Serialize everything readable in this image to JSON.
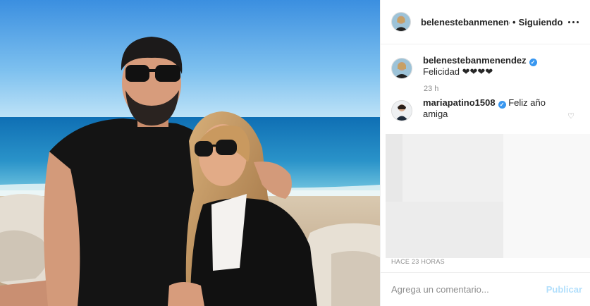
{
  "post": {
    "photo_alt_icon": "photo-image",
    "header": {
      "username": "belenestebanmenendez",
      "separator": "•",
      "follow_status": "Siguiendo",
      "more_icon": "more-options-icon"
    },
    "caption": {
      "username": "belenestebanmenendez",
      "verified": true,
      "text": "Felicidad ❤❤❤❤"
    },
    "caption_time": "23 h",
    "comment": {
      "username": "mariapatino1508",
      "verified": true,
      "text": "Feliz año amiga",
      "like_icon": "heart-icon"
    },
    "timestamp": "HACE 23 HORAS",
    "add_comment": {
      "placeholder": "Agrega un comentario...",
      "submit_label": "Publicar"
    },
    "colors": {
      "link": "#3897f0",
      "publish_disabled": "#b2dffc",
      "muted": "#8e8e8e"
    }
  }
}
